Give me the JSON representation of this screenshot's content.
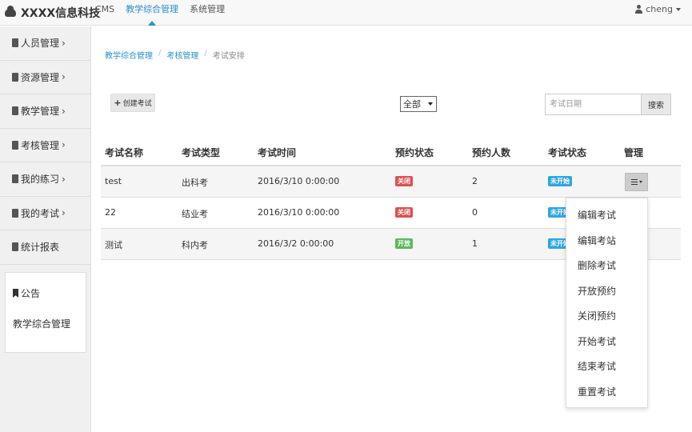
{
  "brand": {
    "title": "XXXX信息科技",
    "icon": "cloud-icon"
  },
  "topnav": {
    "items": [
      "CMS",
      "教学综合管理",
      "系统管理"
    ],
    "active_index": 1
  },
  "user": {
    "name": "cheng",
    "icon": "user-icon"
  },
  "sidebar": {
    "items": [
      {
        "label": "人员管理",
        "chevron": "›"
      },
      {
        "label": "资源管理",
        "chevron": "›"
      },
      {
        "label": "教学管理",
        "chevron": "›"
      },
      {
        "label": "考核管理",
        "chevron": "›"
      },
      {
        "label": "我的练习",
        "chevron": "›"
      },
      {
        "label": "我的考试",
        "chevron": "›"
      },
      {
        "label": "统计报表",
        "chevron": ""
      }
    ],
    "notice": {
      "title": "公告",
      "body": "教学综合管理"
    }
  },
  "breadcrumb": {
    "items": [
      "教学综合管理",
      "考核管理",
      "考试安排"
    ],
    "separator": "/"
  },
  "toolbar": {
    "create_label": "创建考试",
    "filter_value": "全部",
    "search_placeholder": "考试日期",
    "search_label": "搜索"
  },
  "table": {
    "headers": [
      "考试名称",
      "考试类型",
      "考试时间",
      "预约状态",
      "预约人数",
      "考试状态",
      "管理"
    ],
    "rows": [
      {
        "name": "test",
        "type": "出科考",
        "time": "2016/3/10 0:00:00",
        "booking": "关闭",
        "booking_color": "#d9534f",
        "count": "2",
        "status": "未开始"
      },
      {
        "name": "22",
        "type": "结业考",
        "time": "2016/3/10 0:00:00",
        "booking": "关闭",
        "booking_color": "#d9534f",
        "count": "0",
        "status": "未开始"
      },
      {
        "name": "测试",
        "type": "科内考",
        "time": "2016/3/2 0:00:00",
        "booking": "开放",
        "booking_color": "#5cb85c",
        "count": "1",
        "status": "未开始"
      }
    ]
  },
  "dropdown": {
    "items": [
      "编辑考试",
      "编辑考站",
      "删除考试",
      "开放预约",
      "关闭预约",
      "开始考试",
      "结束考试",
      "重置考试"
    ]
  },
  "colors": {
    "accent": "#2a8fce",
    "status_blue": "#2fa4e7",
    "closed_red": "#d9534f",
    "open_green": "#5cb85c"
  }
}
